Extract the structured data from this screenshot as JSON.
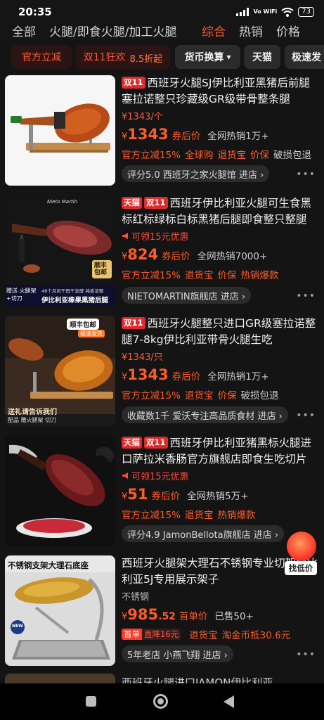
{
  "status": {
    "time": "20:35",
    "network": "Vo WiFi",
    "battery": "73"
  },
  "sort": [
    "全部",
    "火腿/即食火腿/加工火腿",
    "综合",
    "热销",
    "价格"
  ],
  "filters": [
    {
      "label": "官方立减"
    },
    {
      "label": "双11狂欢",
      "sub": "8.5折起"
    },
    {
      "label": "货币换算",
      "caret": "▾"
    },
    {
      "label": "天猫"
    },
    {
      "label": "极速发"
    }
  ],
  "products": [
    {
      "badges": [
        "双11"
      ],
      "title": "西班牙火腿SJ伊比利亚黑猪后前腿塞拉诺整只珍藏级GR级带骨整条腿",
      "sub": "¥1343/个",
      "price_cur": "¥",
      "price": "1343",
      "price_dec": "",
      "price_label": "券后价",
      "sold": "全网热销1万+",
      "benefits": [
        "官方立减15%",
        "全球购",
        "退货宝",
        "价保"
      ],
      "benefits_grey": [
        "破损包退"
      ],
      "store": "评分5.0 西班牙之家火腿馆 进店 ›",
      "more": "•••"
    },
    {
      "badges": [
        "天猫",
        "双11"
      ],
      "title": "西班牙伊比利亚火腿可生食黑标红标绿标白标黑猪后腿即食整只整腿",
      "coupon": "可领15元优惠",
      "price_cur": "¥",
      "price": "824",
      "price_dec": "",
      "price_label": "券后价",
      "sold": "全网热销7000+",
      "benefits": [
        "官方立减15%",
        "退货宝",
        "价保",
        "热销爆款"
      ],
      "benefits_grey": [],
      "store": "NIETOMARTIN旗舰店 进店 ›",
      "more": "•••",
      "thumb": {
        "brand": "Nieto Martín",
        "badge": "顺丰包邮",
        "strip_left": "赠送 火腿架+切刀",
        "strip_mid": "48个月风干再干发酵 纯香浓郁",
        "strip_main": "伊比利亚橡果黑猪后腿"
      }
    },
    {
      "badges": [
        "双11"
      ],
      "title": "西班牙火腿整只进口GR级塞拉诺整腿7-8kg伊比利亚带骨火腿生吃",
      "sub": "¥1343/只",
      "price_cur": "¥",
      "price": "1343",
      "price_dec": "",
      "price_label": "券后价",
      "sold": "全网热销1万+",
      "benefits": [
        "官方立减15%",
        "退货宝",
        "价保"
      ],
      "benefits_grey": [
        "破损包退"
      ],
      "store": "收藏数1千 爱沃专注高品质食材 进店 ›",
      "more": "•••",
      "thumb": {
        "badge": "顺丰包邮",
        "badge_sub": "极速发货",
        "caption": "送礼请告诉我们",
        "caption2": "配品 赠火腿架 切刀"
      }
    },
    {
      "badges": [
        "天猫",
        "双11"
      ],
      "title": "西班牙伊比利亚猪黑标火腿进口萨拉米香肠官方旗舰店即食生吃切片",
      "coupon": "可领15元优惠",
      "price_cur": "¥",
      "price": "51",
      "price_dec": "",
      "price_label": "券后价",
      "sold": "全网热销5万+",
      "benefits": [
        "官方立减15%",
        "退货宝",
        "热销爆款"
      ],
      "benefits_grey": [],
      "store": "评分4.9 JamonBellota旗舰店 进店 ›",
      "more": "•••"
    },
    {
      "badges": [],
      "title": "西班牙火腿架大理石不锈钢专业切架伊比利亚5J专用展示架子",
      "sub_grey": "不锈钢",
      "price_cur": "¥",
      "price": "985",
      "price_dec": ".52",
      "price_label": "首单价",
      "sold": "已售50+",
      "first_tag": "首单",
      "first_sub": "直降16元",
      "benefits": [
        "退货宝",
        "淘金币抵30.6元"
      ],
      "benefits_grey": [],
      "store": "5年老店 小燕飞翔 进店 ›",
      "more": "•••",
      "thumb": {
        "caption": "不锈钢支架大理石底座",
        "badge": "NEW"
      }
    }
  ],
  "peek_title": "西班牙火腿进口JAMON伊比利亚...",
  "float_button": "找低价",
  "colors": {
    "accent": "#ff5a2a",
    "tag": "#e02a2a",
    "bg": "#141414"
  }
}
